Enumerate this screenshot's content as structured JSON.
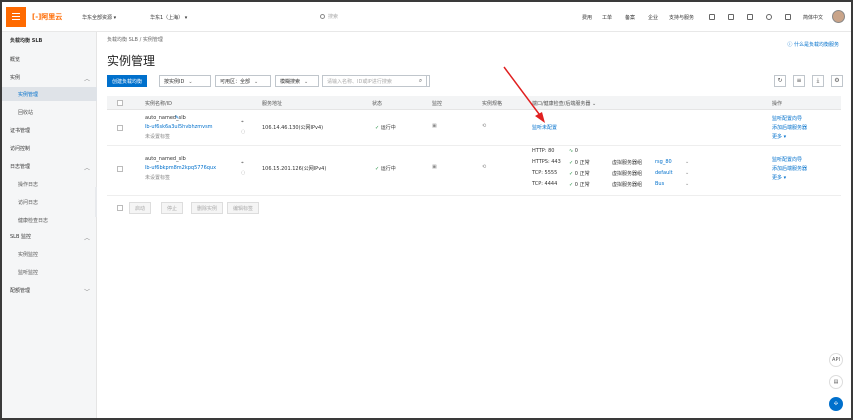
{
  "topbar": {
    "logo": "[-]阿里云",
    "resource_group": "华东全部资源",
    "region": "华东1（上海）",
    "search_placeholder": "搜索",
    "links": [
      "费用",
      "工单",
      "备案",
      "企业",
      "支持与服务"
    ],
    "lang": "简体中文"
  },
  "sidebar": {
    "title": "负载均衡 SLB",
    "items": [
      {
        "label": "概览",
        "type": "item"
      },
      {
        "label": "实例",
        "type": "group"
      },
      {
        "label": "实例管理",
        "type": "sub",
        "active": true
      },
      {
        "label": "回收站",
        "type": "sub"
      },
      {
        "label": "证书管理",
        "type": "item"
      },
      {
        "label": "访问控制",
        "type": "item"
      },
      {
        "label": "日志管理",
        "type": "group"
      },
      {
        "label": "操作日志",
        "type": "sub"
      },
      {
        "label": "访问日志",
        "type": "sub"
      },
      {
        "label": "健康检查日志",
        "type": "sub"
      },
      {
        "label": "SLB 监控",
        "type": "group"
      },
      {
        "label": "实例监控",
        "type": "sub"
      },
      {
        "label": "监听监控",
        "type": "sub"
      },
      {
        "label": "配额管理",
        "type": "group"
      }
    ]
  },
  "main": {
    "breadcrumb": "负载均衡 SLB  /  实例管理",
    "title": "实例管理",
    "help_link": "什么是负载均衡服务",
    "toolbar": {
      "create": "创建负载均衡",
      "filter1": "按实例ID",
      "filter2": "可用区：全部",
      "filter3": "模糊搜索",
      "search_placeholder": "请输入名称、ID或IP进行搜索"
    },
    "columns": [
      "实例名称/ID",
      "服务地址",
      "状态",
      "监控",
      "实例规格",
      "端口/健康检查/后端服务器",
      "操作"
    ],
    "rows": [
      {
        "name": "auto_named_slb",
        "id": "lb-uf6sk6a3ul5hvbhzmvsm",
        "tag": "未设置标签",
        "address": "106.14.46.130(公网IPv4)",
        "status": "运行中",
        "ports_link": "监听未配置",
        "listeners": [],
        "actions": [
          "监听配置向导",
          "添加后端服务器",
          "更多"
        ]
      },
      {
        "name": "auto_named_slb",
        "id": "lb-uf6bkpm8m2kpq5776qux",
        "tag": "未设置标签",
        "address": "106.15.201.126(公网IPv4)",
        "status": "运行中",
        "ports_link": "",
        "listeners": [
          {
            "proto": "HTTP: 80",
            "health": "0",
            "state": "",
            "group_label": "",
            "group": ""
          },
          {
            "proto": "HTTPS: 443",
            "health": "0",
            "state": "正常",
            "group_label": "虚拟服务器组",
            "group": "rsg_80"
          },
          {
            "proto": "TCP: 5555",
            "health": "0",
            "state": "正常",
            "group_label": "虚拟服务器组",
            "group": "default"
          },
          {
            "proto": "TCP: 4444",
            "health": "0",
            "state": "正常",
            "group_label": "虚拟服务器组",
            "group": "Bus"
          }
        ],
        "actions": [
          "监听配置向导",
          "添加后端服务器",
          "更多"
        ]
      }
    ],
    "bulk_actions": [
      "启动",
      "停止",
      "删除实例",
      "编辑标签"
    ]
  },
  "floating": [
    "API",
    "文档"
  ],
  "colors": {
    "accent": "#0070cc",
    "brand": "#ff6a00",
    "arrow": "#e02020"
  }
}
